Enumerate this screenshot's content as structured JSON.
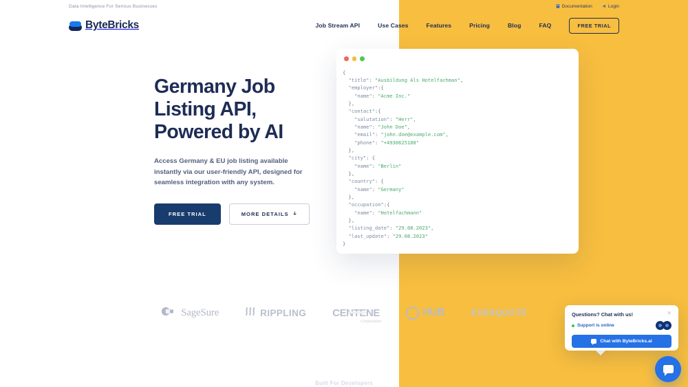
{
  "topbar": {
    "tagline": "Data Intelligence For Serious Businesses",
    "links": [
      {
        "label": "Documentation",
        "icon": "book-icon"
      },
      {
        "label": "Login",
        "icon": "login-icon"
      }
    ]
  },
  "nav": {
    "brand": "ByteBricks",
    "brand_icon": "bytebricks-logo-icon",
    "links": [
      "Job Stream API",
      "Use Cases",
      "Features",
      "Pricing",
      "Blog",
      "FAQ"
    ],
    "cta": "FREE TRIAL"
  },
  "hero": {
    "title": "Germany Job Listing API, Powered by AI",
    "subtitle": "Access Germany & EU job listing available instantly via our user-friendly API, designed for seamless integration with any system.",
    "primary_button": "FREE TRIAL",
    "secondary_button": "MORE DETAILS",
    "secondary_button_icon": "arrow-down-icon"
  },
  "code_card": {
    "window_dots": [
      "close-red",
      "minimize-yellow",
      "maximize-green"
    ],
    "lines": [
      {
        "indent": 0,
        "segments": [
          {
            "t": "punct",
            "v": "{"
          }
        ]
      },
      {
        "indent": 1,
        "segments": [
          {
            "t": "key",
            "v": "\"title\""
          },
          {
            "t": "punct",
            "v": ": "
          },
          {
            "t": "str",
            "v": "\"Ausbildung Als Hotelfachman\""
          },
          {
            "t": "punct",
            "v": ","
          }
        ]
      },
      {
        "indent": 1,
        "segments": [
          {
            "t": "key",
            "v": "\"employer\""
          },
          {
            "t": "punct",
            "v": ":{"
          }
        ]
      },
      {
        "indent": 2,
        "segments": [
          {
            "t": "key",
            "v": "\"name\""
          },
          {
            "t": "punct",
            "v": ": "
          },
          {
            "t": "str",
            "v": "\"Acme Inc.\""
          }
        ]
      },
      {
        "indent": 1,
        "segments": [
          {
            "t": "punct",
            "v": "},"
          }
        ]
      },
      {
        "indent": 1,
        "segments": [
          {
            "t": "key",
            "v": "\"contact\""
          },
          {
            "t": "punct",
            "v": ":{"
          }
        ]
      },
      {
        "indent": 2,
        "segments": [
          {
            "t": "key",
            "v": "\"salutation\""
          },
          {
            "t": "punct",
            "v": ": "
          },
          {
            "t": "str",
            "v": "\"Herr\""
          },
          {
            "t": "punct",
            "v": ","
          }
        ]
      },
      {
        "indent": 2,
        "segments": [
          {
            "t": "key",
            "v": "\"name\""
          },
          {
            "t": "punct",
            "v": ": "
          },
          {
            "t": "str",
            "v": "\"John Doe\""
          },
          {
            "t": "punct",
            "v": ","
          }
        ]
      },
      {
        "indent": 2,
        "segments": [
          {
            "t": "key",
            "v": "\"email\""
          },
          {
            "t": "punct",
            "v": ": "
          },
          {
            "t": "str",
            "v": "\"john.doe@example.com\""
          },
          {
            "t": "punct",
            "v": ","
          }
        ]
      },
      {
        "indent": 2,
        "segments": [
          {
            "t": "key",
            "v": "\"phone\""
          },
          {
            "t": "punct",
            "v": ": "
          },
          {
            "t": "str",
            "v": "\"+4930625188\""
          }
        ]
      },
      {
        "indent": 1,
        "segments": [
          {
            "t": "punct",
            "v": "},"
          }
        ]
      },
      {
        "indent": 1,
        "segments": [
          {
            "t": "key",
            "v": "\"city\""
          },
          {
            "t": "punct",
            "v": ": {"
          }
        ]
      },
      {
        "indent": 2,
        "segments": [
          {
            "t": "key",
            "v": "\"name\""
          },
          {
            "t": "punct",
            "v": ": "
          },
          {
            "t": "str",
            "v": "\"Berlin\""
          }
        ]
      },
      {
        "indent": 1,
        "segments": [
          {
            "t": "punct",
            "v": "},"
          }
        ]
      },
      {
        "indent": 1,
        "segments": [
          {
            "t": "key",
            "v": "\"country\""
          },
          {
            "t": "punct",
            "v": ": {"
          }
        ]
      },
      {
        "indent": 2,
        "segments": [
          {
            "t": "key",
            "v": "\"name\""
          },
          {
            "t": "punct",
            "v": ": "
          },
          {
            "t": "str",
            "v": "\"Germany\""
          }
        ]
      },
      {
        "indent": 1,
        "segments": [
          {
            "t": "punct",
            "v": "},"
          }
        ]
      },
      {
        "indent": 1,
        "segments": [
          {
            "t": "key",
            "v": "\"occupation\""
          },
          {
            "t": "punct",
            "v": ":{"
          }
        ]
      },
      {
        "indent": 2,
        "segments": [
          {
            "t": "key",
            "v": "\"name\""
          },
          {
            "t": "punct",
            "v": ": "
          },
          {
            "t": "str",
            "v": "\"Hotelfachmann\""
          }
        ]
      },
      {
        "indent": 1,
        "segments": [
          {
            "t": "punct",
            "v": "},"
          }
        ]
      },
      {
        "indent": 1,
        "segments": [
          {
            "t": "key",
            "v": "\"listing_date\""
          },
          {
            "t": "punct",
            "v": ": "
          },
          {
            "t": "str",
            "v": "\"29.08.2023\""
          },
          {
            "t": "punct",
            "v": ","
          }
        ]
      },
      {
        "indent": 1,
        "segments": [
          {
            "t": "key",
            "v": "\"last_update\""
          },
          {
            "t": "punct",
            "v": ": "
          },
          {
            "t": "str",
            "v": "\"29.08.2023\""
          }
        ]
      },
      {
        "indent": 0,
        "segments": [
          {
            "t": "punct",
            "v": "}"
          }
        ]
      }
    ]
  },
  "logos": [
    {
      "name": "SageSure",
      "style": "sagesure"
    },
    {
      "name": "RIPPLING",
      "style": "rippling"
    },
    {
      "name": "CENTENE",
      "style": "centene",
      "sub": "Corporation"
    },
    {
      "name": "HUB",
      "style": "hub"
    },
    {
      "name": "EVERQUOTE",
      "style": "everquote"
    }
  ],
  "footer_peek": {
    "text": "Built For Developers"
  },
  "chat": {
    "title": "Questions? Chat with us!",
    "close_icon": "close-icon",
    "status": "Support is online",
    "status_color": "#34c759",
    "button": "Chat with ByteBricks.ai",
    "button_icon": "chat-bubble-icon",
    "fab_icon": "chat-bubble-icon"
  },
  "colors": {
    "yellow": "#f7be3f",
    "navy": "#1e2d55",
    "blue": "#2571e6",
    "page_bg": "#f8f9fd"
  }
}
